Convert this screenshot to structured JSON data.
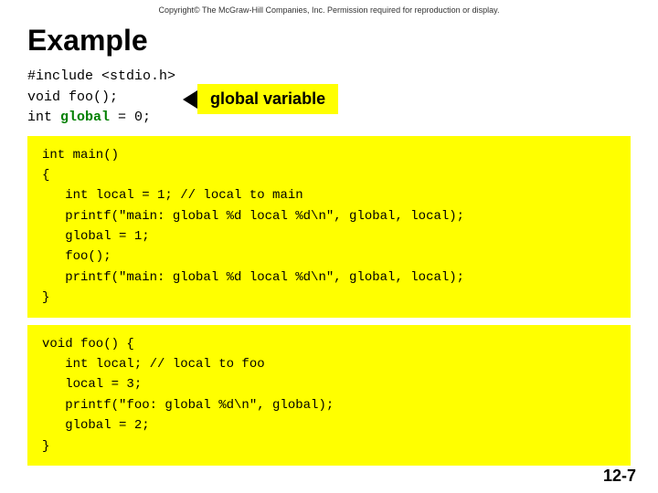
{
  "copyright": "Copyright© The McGraw-Hill Companies, Inc. Permission required for reproduction or display.",
  "title": "Example",
  "top_code": {
    "line1": "#include <stdio.h>",
    "line2": "void foo();",
    "line3_prefix": "int ",
    "line3_green": "global",
    "line3_suffix": " = 0;"
  },
  "label": "global variable",
  "main_code": "int main()\n{\n   int local = 1; // local to main\n   printf(\"main: global %d local %d\\n\", global, local);\n   global = 1;\n   foo();\n   printf(\"main: global %d local %d\\n\", global, local);\n}",
  "foo_code": "void foo() {\n   int local; // local to foo\n   local = 3;\n   printf(\"foo: global %d\\n\", global);\n   global = 2;\n}",
  "page_number": "12-7"
}
